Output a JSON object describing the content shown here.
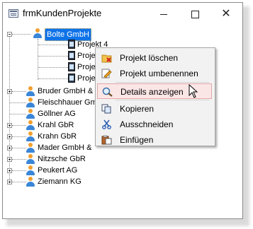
{
  "window": {
    "title": "frmKundenProjekte",
    "minimize": "minimize",
    "maximize": "maximize",
    "close": "close"
  },
  "tree": {
    "customers": [
      {
        "label": "Bolte GmbH",
        "expanded": true,
        "selected": true
      },
      {
        "label": "Bruder GmbH &"
      },
      {
        "label": "Fleischhauer Gm"
      },
      {
        "label": "Göllner AG"
      },
      {
        "label": "Krahl GbR"
      },
      {
        "label": "Krahn GbR"
      },
      {
        "label": "Mader GmbH &"
      },
      {
        "label": "Nitzsche GbR"
      },
      {
        "label": "Peukert AG"
      },
      {
        "label": "Ziemann KG"
      }
    ],
    "projects": [
      {
        "label": "Projekt 4"
      },
      {
        "label": "Projekt"
      },
      {
        "label": "Projekt"
      },
      {
        "label": "Projekte"
      }
    ]
  },
  "context_menu": {
    "items": [
      {
        "label": "Projekt löschen",
        "icon": "folder-delete-icon"
      },
      {
        "label": "Projekt umbenennen",
        "icon": "rename-icon"
      },
      {
        "label": "Details anzeigen",
        "icon": "details-icon",
        "hovered": true
      },
      {
        "label": "Kopieren",
        "icon": "copy-icon"
      },
      {
        "label": "Ausschneiden",
        "icon": "cut-icon"
      },
      {
        "label": "Einfügen",
        "icon": "paste-icon"
      }
    ]
  },
  "colors": {
    "selection": "#0f73e8",
    "hover_bg": "#fbe6e6",
    "hover_border": "#e3a8a8"
  }
}
